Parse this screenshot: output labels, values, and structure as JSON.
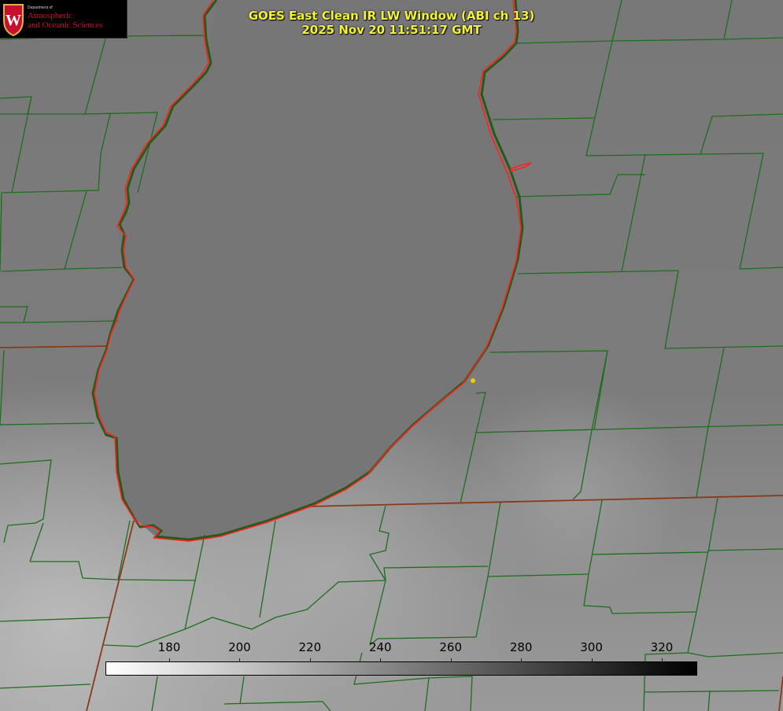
{
  "header": {
    "title_line1": "GOES East Clean IR LW Window (ABI ch 13)",
    "title_line2": "2025 Nov 20 11:51:17 GMT"
  },
  "logo": {
    "department": "Department of",
    "line1": "Atmospheric",
    "line2": "and Oceanic Sciences",
    "crest_letter": "W"
  },
  "colorbar": {
    "ticks": [
      {
        "value": 180,
        "label": "180"
      },
      {
        "value": 200,
        "label": "200"
      },
      {
        "value": 220,
        "label": "220"
      },
      {
        "value": 240,
        "label": "240"
      },
      {
        "value": 260,
        "label": "260"
      },
      {
        "value": 280,
        "label": "280"
      },
      {
        "value": 300,
        "label": "300"
      },
      {
        "value": 320,
        "label": "320"
      }
    ],
    "colors": {
      "low": "#ffffff",
      "high": "#000000"
    }
  },
  "map_colors": {
    "background": "#7a7a7a",
    "lake": "#757575",
    "county_lines": "#1d6e1d",
    "lake_outline": "#ff2020",
    "state_line": "#8a3a1a",
    "marker": "#e8d000"
  }
}
